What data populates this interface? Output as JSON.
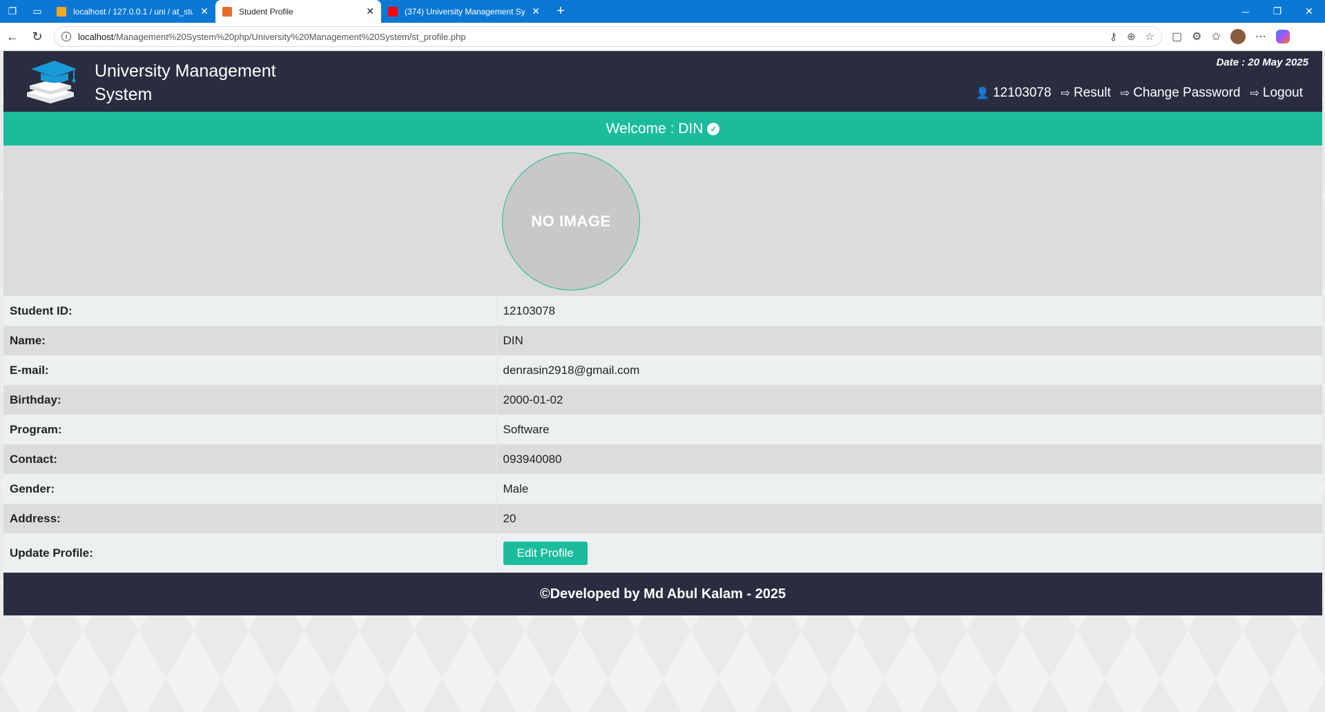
{
  "browser": {
    "tabs": [
      {
        "title": "localhost / 127.0.0.1 / uni / at_stu",
        "favicon_color": "#f5a623"
      },
      {
        "title": "Student Profile",
        "favicon_color": "#e86a2c",
        "active": true
      },
      {
        "title": "(374) University Management Sys",
        "favicon_color": "#ff0000"
      }
    ],
    "url_host": "localhost",
    "url_path": "/Management%20System%20php/University%20Management%20System/st_profile.php"
  },
  "header": {
    "title": "University Management System",
    "date": "Date : 20 May 2025",
    "nav": {
      "user": "12103078",
      "result": "Result",
      "change_password": "Change Password",
      "logout": "Logout"
    }
  },
  "welcome": "Welcome : DIN",
  "photo_placeholder": "NO IMAGE",
  "profile": {
    "rows": [
      {
        "label": "Student ID:",
        "value": "12103078"
      },
      {
        "label": "Name:",
        "value": "DIN"
      },
      {
        "label": "E-mail:",
        "value": "denrasin2918@gmail.com"
      },
      {
        "label": "Birthday:",
        "value": "2000-01-02"
      },
      {
        "label": "Program:",
        "value": "Software"
      },
      {
        "label": "Contact:",
        "value": "093940080"
      },
      {
        "label": "Gender:",
        "value": "Male"
      },
      {
        "label": "Address:",
        "value": "20"
      }
    ],
    "update_label": "Update Profile:",
    "edit_button": "Edit Profile"
  },
  "footer": "©Developed by Md Abul Kalam - 2025",
  "colors": {
    "header_bg": "#2a2d3f",
    "accent": "#1abc9c",
    "browser_bar": "#0a78d4"
  }
}
